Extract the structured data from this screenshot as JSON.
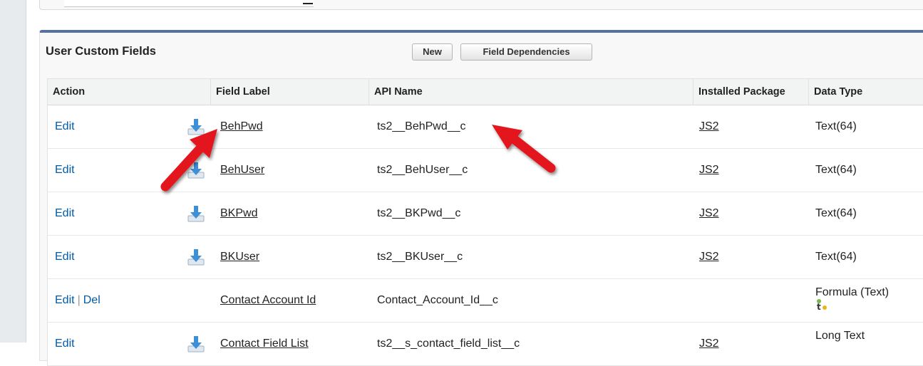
{
  "page": {
    "colors": {
      "header_accent": "#56729a",
      "link": "#015ba7",
      "arrow": "#e2171e"
    }
  },
  "related_list": {
    "title": "User Custom Fields",
    "buttons": {
      "new": "New",
      "field_dependencies": "Field Dependencies"
    },
    "columns": [
      "Action",
      "Field Label",
      "API Name",
      "Installed Package",
      "Data Type"
    ],
    "rows": [
      {
        "actions": [
          "Edit"
        ],
        "installed": true,
        "label": "BehPwd",
        "api": "ts2__BehPwd__c",
        "package": "JS2",
        "type": "Text(64)"
      },
      {
        "actions": [
          "Edit"
        ],
        "installed": true,
        "label": "BehUser",
        "api": "ts2__BehUser__c",
        "package": "JS2",
        "type": "Text(64)"
      },
      {
        "actions": [
          "Edit"
        ],
        "installed": true,
        "label": "BKPwd",
        "api": "ts2__BKPwd__c",
        "package": "JS2",
        "type": "Text(64)"
      },
      {
        "actions": [
          "Edit"
        ],
        "installed": true,
        "label": "BKUser",
        "api": "ts2__BKUser__c",
        "package": "JS2",
        "type": "Text(64)"
      },
      {
        "actions": [
          "Edit",
          "Del"
        ],
        "installed": false,
        "label": "Contact Account Id",
        "api": "Contact_Account_Id__c",
        "package": "",
        "type": "Formula (Text)",
        "type_icon": "formula-indicator-icon"
      },
      {
        "actions": [
          "Edit"
        ],
        "installed": true,
        "label": "Contact Field List",
        "api": "ts2__s_contact_field_list__c",
        "package": "JS2",
        "type": "Long Text"
      }
    ]
  },
  "icons": {
    "installed": "install-download-icon",
    "annotation": "red-arrow-annotation-icon"
  }
}
